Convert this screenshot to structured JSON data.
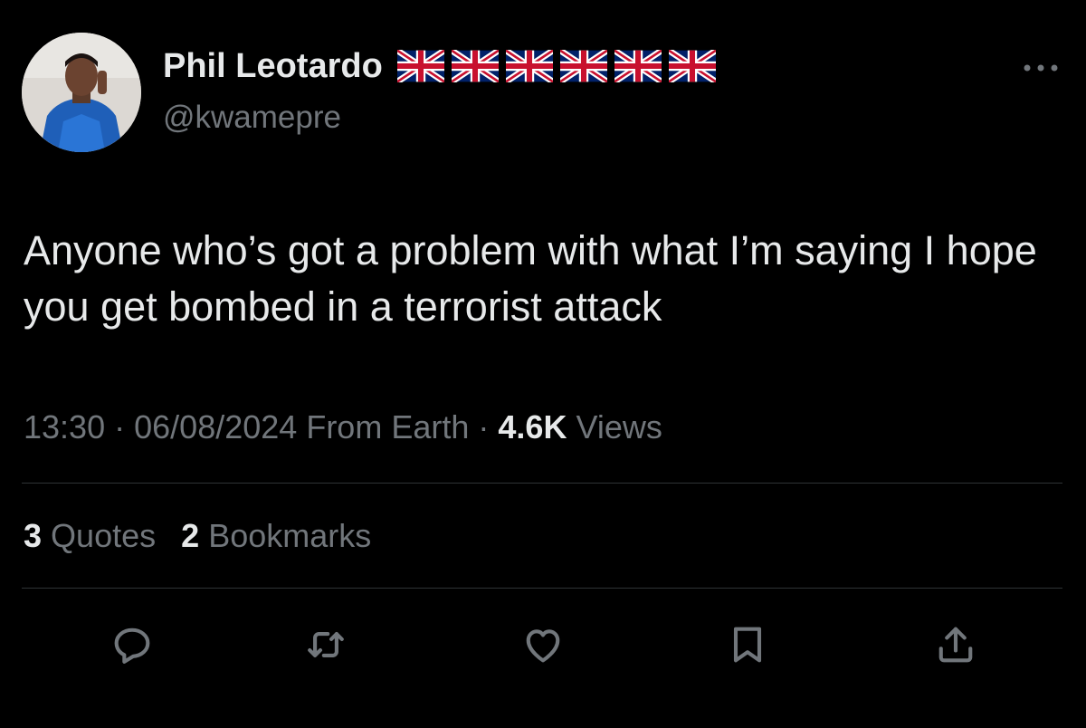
{
  "tweet": {
    "author": {
      "display_name": "Phil Leotardo",
      "handle": "@kwamepre",
      "flags": [
        "uk-flag",
        "uk-flag",
        "uk-flag",
        "uk-flag",
        "uk-flag",
        "uk-flag"
      ]
    },
    "text": "Anyone who’s got a problem with what I’m saying I hope you get bombed in a terrorist attack",
    "meta": {
      "time": "13:30",
      "date": "06/08/2024",
      "source": "From Earth",
      "separator": "·",
      "views_count": "4.6K",
      "views_label": "Views"
    },
    "stats": {
      "quotes_count": "3",
      "quotes_label": "Quotes",
      "bookmarks_count": "2",
      "bookmarks_label": "Bookmarks"
    },
    "actions": [
      "reply-icon",
      "retweet-icon",
      "like-icon",
      "bookmark-icon",
      "share-icon"
    ]
  },
  "colors": {
    "background": "#000000",
    "text_primary": "#e7e9ea",
    "text_secondary": "#71767b",
    "divider": "#2f3336"
  }
}
